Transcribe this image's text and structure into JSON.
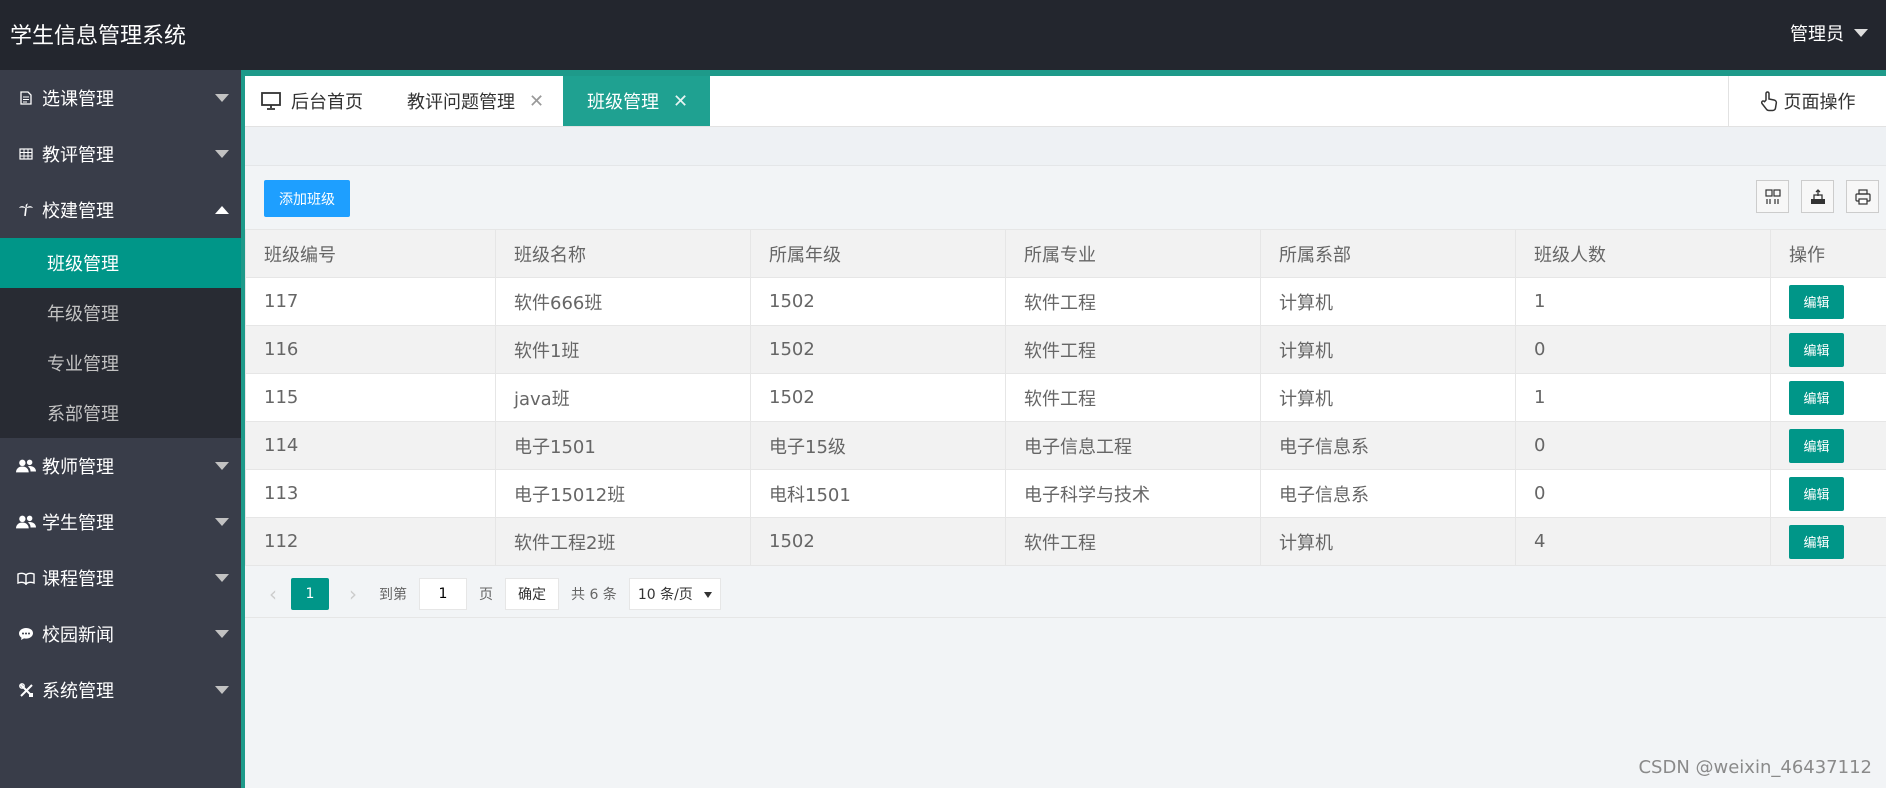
{
  "app": {
    "title": "学生信息管理系统",
    "user": "管理员"
  },
  "sidebar": {
    "groups": [
      {
        "label": "选课管理",
        "icon": "document-icon",
        "expanded": false
      },
      {
        "label": "教评管理",
        "icon": "table-icon",
        "expanded": false
      },
      {
        "label": "校建管理",
        "icon": "palm-tree-icon",
        "expanded": true,
        "children": [
          "班级管理",
          "年级管理",
          "专业管理",
          "系部管理"
        ],
        "active_child": "班级管理"
      },
      {
        "label": "教师管理",
        "icon": "users-icon",
        "expanded": false
      },
      {
        "label": "学生管理",
        "icon": "users-icon",
        "expanded": false
      },
      {
        "label": "课程管理",
        "icon": "book-icon",
        "expanded": false
      },
      {
        "label": "校园新闻",
        "icon": "speech-bubble-icon",
        "expanded": false
      },
      {
        "label": "系统管理",
        "icon": "tools-icon",
        "expanded": false
      }
    ]
  },
  "tabs": [
    {
      "label": "后台首页",
      "icon": "monitor-icon",
      "closable": false
    },
    {
      "label": "教评问题管理",
      "closable": true
    },
    {
      "label": "班级管理",
      "closable": true,
      "active": true
    }
  ],
  "page_ops": {
    "label": "页面操作",
    "icon": "pointer-hand-icon"
  },
  "toolbar": {
    "add_label": "添加班级",
    "tools": [
      "columns-icon",
      "export-icon",
      "print-icon"
    ]
  },
  "table": {
    "headers": [
      "班级编号",
      "班级名称",
      "所属年级",
      "所属专业",
      "所属系部",
      "班级人数",
      "操作"
    ],
    "rows": [
      [
        "117",
        "软件666班",
        "1502",
        "软件工程",
        "计算机",
        "1"
      ],
      [
        "116",
        "软件1班",
        "1502",
        "软件工程",
        "计算机",
        "0"
      ],
      [
        "115",
        "java班",
        "1502",
        "软件工程",
        "计算机",
        "1"
      ],
      [
        "114",
        "电子1501",
        "电子15级",
        "电子信息工程",
        "电子信息系",
        "0"
      ],
      [
        "113",
        "电子15012班",
        "电科1501",
        "电子科学与技术",
        "电子信息系",
        "0"
      ],
      [
        "112",
        "软件工程2班",
        "1502",
        "软件工程",
        "计算机",
        "4"
      ]
    ],
    "edit_label": "编辑"
  },
  "pager": {
    "current": "1",
    "goto_label": "到第",
    "goto_value": "1",
    "page_unit": "页",
    "confirm": "确定",
    "total": "共 6 条",
    "page_size": "10 条/页"
  },
  "watermark": "CSDN @weixin_46437112",
  "colors": {
    "header": "#23262e",
    "sidebar": "#393d49",
    "accent": "#009688",
    "primary_button": "#1e9fff"
  }
}
